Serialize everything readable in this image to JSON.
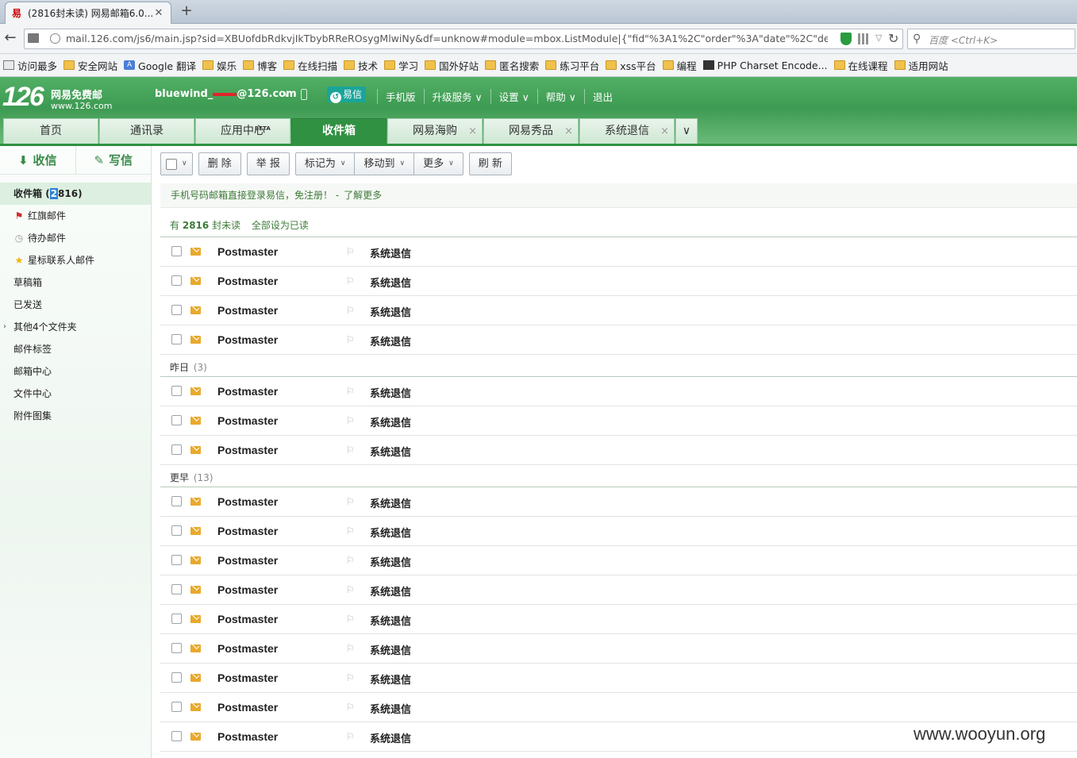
{
  "browser": {
    "tab_title": "(2816封未读) 网易邮箱6.0...",
    "tab_close": "✕",
    "new_tab": "+",
    "url": "mail.126.com/js6/main.jsp?sid=XBUofdbRdkvjIkTbybRReROsygMlwiNy&df=unknow#module=mbox.ListModule|{\"fid\"%3A1%2C\"order\"%3A\"date\"%2C\"desc\"%3Atrue}",
    "search_placeholder": "百度 <Ctrl+K>"
  },
  "bookmarks": [
    "访问最多",
    "安全网站",
    "Google 翻译",
    "娱乐",
    "博客",
    "在线扫描",
    "技术",
    "学习",
    "国外好站",
    "匿名搜索",
    "练习平台",
    "xss平台",
    "编程",
    "PHP Charset Encode...",
    "在线课程",
    "适用网站"
  ],
  "header": {
    "logo_number": "126",
    "logo_title": "网易免费邮",
    "logo_url": "www.126.com",
    "account": "bluewind_[redacted]@126.com",
    "account_prefix": "bluewind_",
    "account_suffix": "@126.com",
    "yixin": "易信",
    "links": [
      "手机版",
      "升级服务",
      "设置",
      "帮助",
      "退出"
    ]
  },
  "nav_tabs": [
    {
      "label": "首页"
    },
    {
      "label": "通讯录"
    },
    {
      "label": "应用中心",
      "badge": "BETA"
    },
    {
      "label": "收件箱",
      "active": true
    },
    {
      "label": "网易海购",
      "closable": true
    },
    {
      "label": "网易秀品",
      "closable": true
    },
    {
      "label": "系统退信",
      "closable": true
    }
  ],
  "sidebar": {
    "receive": "收信",
    "compose": "写信",
    "inbox_label": "收件箱",
    "inbox_count_hl": "2",
    "inbox_count_rest": "816",
    "folders": [
      "红旗邮件",
      "待办邮件",
      "星标联系人邮件",
      "草稿箱",
      "已发送",
      "其他4个文件夹",
      "邮件标签",
      "邮箱中心",
      "文件中心",
      "附件图集"
    ]
  },
  "toolbar": {
    "delete": "删 除",
    "report": "举 报",
    "mark_as": "标记为",
    "move_to": "移动到",
    "more": "更多",
    "refresh": "刷 新"
  },
  "notice": {
    "text": "手机号码邮箱直接登录易信，免注册！ -",
    "link": "了解更多"
  },
  "unread": {
    "prefix": "有",
    "count": "2816",
    "suffix": "封未读",
    "mark_all": "全部设为已读"
  },
  "groups": [
    {
      "label": "",
      "count": "",
      "rows": 4
    },
    {
      "label": "昨日",
      "count": "(3)",
      "rows": 3
    },
    {
      "label": "更早",
      "count": "(13)",
      "rows": 9
    }
  ],
  "mail": {
    "from": "Postmaster",
    "subject": "系统退信"
  },
  "watermark": "www.wooyun.org"
}
